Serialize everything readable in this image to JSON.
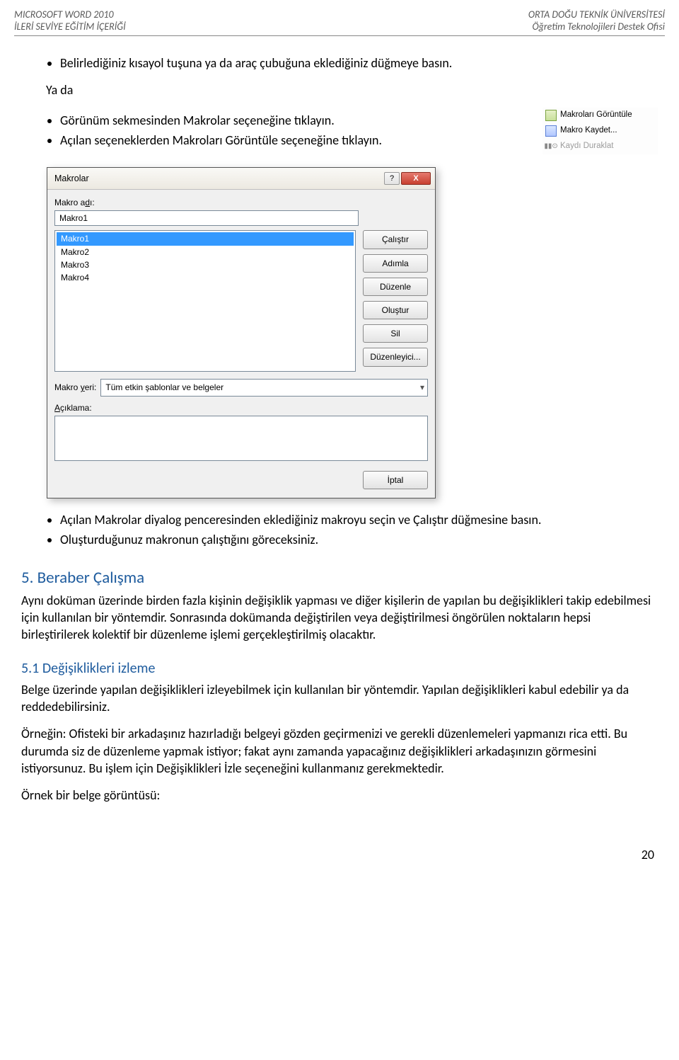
{
  "header": {
    "left_top": "MICROSOFT WORD 2010",
    "left_bottom": "İLERİ SEVİYE EĞİTİM İÇERİĞİ",
    "right_top": "ORTA DOĞU TEKNİK ÜNİVERSİTESİ",
    "right_bottom": "Öğretim Teknolojileri Destek Ofisi"
  },
  "bullets1": {
    "b1": "Belirlediğiniz kısayol tuşuna ya da araç çubuğuna eklediğiniz düğmeye basın."
  },
  "yada": "Ya da",
  "bullets2": {
    "b1": "Görünüm sekmesinden Makrolar seçeneğine tıklayın.",
    "b2": "Açılan seçeneklerden Makroları Görüntüle seçeneğine tıklayın."
  },
  "side_menu": {
    "item1": "Makroları Görüntüle",
    "item2": "Makro Kaydet...",
    "item3": "Kaydı Duraklat"
  },
  "dialog": {
    "title": "Makrolar",
    "lbl_macro_name_prefix": "Makro a",
    "lbl_macro_name_u": "d",
    "lbl_macro_name_suffix": "ı:",
    "macro_name_value": "Makro1",
    "list": {
      "i0": "Makro1",
      "i1": "Makro2",
      "i2": "Makro3",
      "i3": "Makro4"
    },
    "btns": {
      "run": "Çalıştır",
      "step": "Adımla",
      "edit": "Düzenle",
      "create": "Oluştur",
      "delete": "Sil",
      "organizer": "Düzenleyici...",
      "cancel": "İptal"
    },
    "lbl_macro_loc_prefix": "Makro ",
    "lbl_macro_loc_u": "y",
    "lbl_macro_loc_suffix": "eri:",
    "macro_loc_value": "Tüm etkin şablonlar ve belgeler",
    "lbl_desc_u": "A",
    "lbl_desc_suffix": "çıklama:"
  },
  "bullets3": {
    "b1": "Açılan Makrolar diyalog penceresinden eklediğiniz makroyu seçin ve Çalıştır düğmesine basın.",
    "b2": "Oluşturduğunuz makronun çalıştığını göreceksiniz."
  },
  "sect5_title": "5. Beraber Çalışma",
  "sect5_p": "Aynı doküman üzerinde birden fazla kişinin değişiklik yapması ve diğer kişilerin de yapılan bu değişiklikleri takip edebilmesi için kullanılan bir yöntemdir. Sonrasında dokümanda değiştirilen veya değiştirilmesi öngörülen noktaların hepsi birleştirilerek kolektif bir düzenleme işlemi gerçekleştirilmiş olacaktır.",
  "sect51_title": "5.1 Değişiklikleri izleme",
  "sect51_p1": "Belge üzerinde yapılan değişiklikleri izleyebilmek için kullanılan bir yöntemdir. Yapılan değişiklikleri kabul edebilir ya da reddedebilirsiniz.",
  "sect51_p2": "Örneğin: Ofisteki bir arkadaşınız hazırladığı belgeyi gözden geçirmenizi ve gerekli düzenlemeleri yapmanızı rica etti. Bu durumda siz de düzenleme yapmak istiyor; fakat aynı zamanda yapacağınız değişiklikleri arkadaşınızın görmesini istiyorsunuz. Bu işlem için Değişiklikleri İzle seçeneğini kullanmanız gerekmektedir.",
  "sect51_p3": "Örnek bir belge görüntüsü:",
  "page_num": "20"
}
